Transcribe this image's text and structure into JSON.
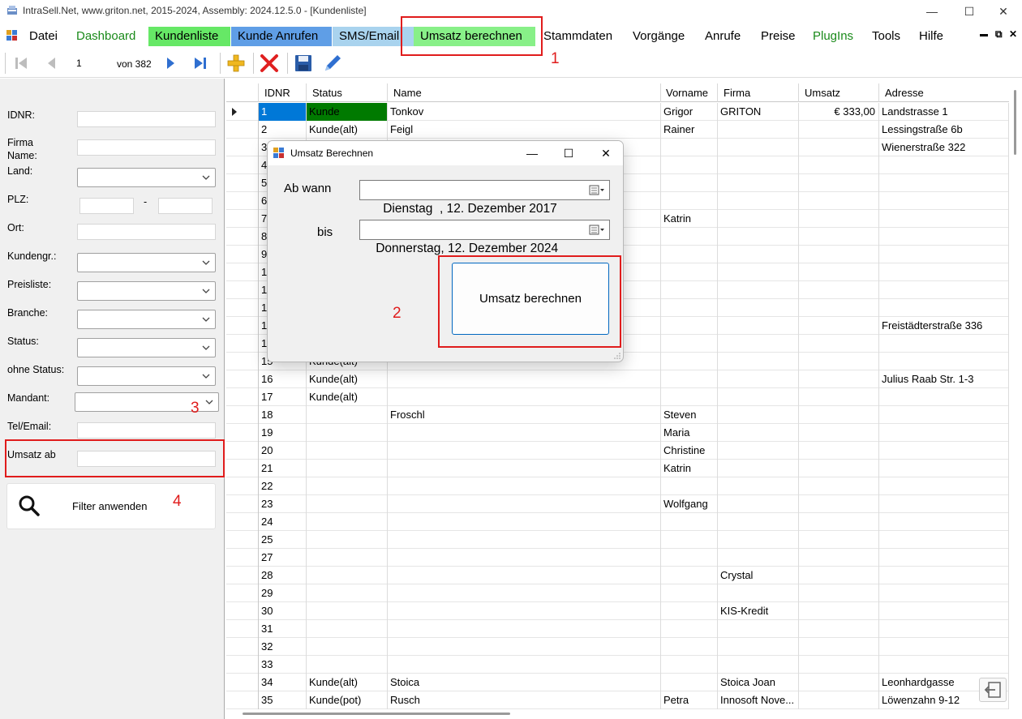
{
  "window": {
    "title": "IntraSell.Net, www.griton.net, 2015-2024, Assembly: 2024.12.5.0 - [Kundenliste]",
    "minimize": "—",
    "maximize": "☐",
    "close": "✕"
  },
  "menu": {
    "items": [
      {
        "label": "Datei",
        "bg": "",
        "color": "#000000"
      },
      {
        "label": "Dashboard",
        "bg": "",
        "color": "#1a8a1a"
      },
      {
        "label": "Kundenliste",
        "bg": "#66e866",
        "color": "#000000"
      },
      {
        "label": "Kunde Anrufen",
        "bg": "#5f9ee6",
        "color": "#000000"
      },
      {
        "label": "SMS/Email",
        "bg": "#a9d3ee",
        "color": "#000000"
      },
      {
        "label": "Umsatz berechnen",
        "bg": "#88f088",
        "color": "#000000"
      },
      {
        "label": "Stammdaten",
        "bg": "",
        "color": "#000000"
      },
      {
        "label": "Vorgänge",
        "bg": "",
        "color": "#000000"
      },
      {
        "label": "Anrufe",
        "bg": "",
        "color": "#000000"
      },
      {
        "label": "Preise",
        "bg": "",
        "color": "#000000"
      },
      {
        "label": "PlugIns",
        "bg": "",
        "color": "#1a8a1a"
      },
      {
        "label": "Tools",
        "bg": "",
        "color": "#000000"
      },
      {
        "label": "Hilfe",
        "bg": "",
        "color": "#000000"
      }
    ],
    "mdi_minimize": "▬",
    "mdi_restore": "⧉",
    "mdi_close": "✕"
  },
  "toolbar": {
    "record_value": "1",
    "record_of": "von 382"
  },
  "filter": {
    "idnr_label": "IDNR:",
    "firma_label_1": "Firma",
    "firma_label_2": "Name:",
    "land_label": "Land:",
    "plz_label": "PLZ:",
    "plz_dash": "-",
    "ort_label": "Ort:",
    "kundengr_label": "Kundengr.:",
    "preisliste_label": "Preisliste:",
    "branche_label": "Branche:",
    "status_label": "Status:",
    "ohne_status_label": "ohne Status:",
    "mandant_label": "Mandant:",
    "telemail_label": "Tel/Email:",
    "umsatz_ab_label": "Umsatz ab",
    "apply_button": "Filter anwenden"
  },
  "grid": {
    "columns": [
      "IDNR",
      "Status",
      "Name",
      "Vorname",
      "Firma",
      "Umsatz",
      "Adresse"
    ],
    "rows": [
      {
        "id": "1",
        "status": "Kunde",
        "name": "Tonkov",
        "vorname": "Grigor",
        "firma": "GRITON",
        "umsatz": "€ 333,00",
        "adresse": "Landstrasse 1"
      },
      {
        "id": "2",
        "status": "Kunde(alt)",
        "name": "Feigl",
        "vorname": "Rainer",
        "firma": "",
        "umsatz": "",
        "adresse": "Lessingstraße 6b"
      },
      {
        "id": "3",
        "status": "",
        "name": "",
        "vorname": "",
        "firma": "",
        "umsatz": "",
        "adresse": "Wienerstraße 322"
      },
      {
        "id": "4",
        "status": "",
        "name": "",
        "vorname": "",
        "firma": "",
        "umsatz": "",
        "adresse": ""
      },
      {
        "id": "5",
        "status": "",
        "name": "",
        "vorname": "",
        "firma": "",
        "umsatz": "",
        "adresse": ""
      },
      {
        "id": "6",
        "status": "",
        "name": "",
        "vorname": "",
        "firma": "",
        "umsatz": "",
        "adresse": ""
      },
      {
        "id": "7",
        "status": "",
        "name": "",
        "vorname": "Katrin",
        "firma": "",
        "umsatz": "",
        "adresse": ""
      },
      {
        "id": "8",
        "status": "",
        "name": "",
        "vorname": "",
        "firma": "",
        "umsatz": "",
        "adresse": ""
      },
      {
        "id": "9",
        "status": "",
        "name": "",
        "vorname": "",
        "firma": "",
        "umsatz": "",
        "adresse": ""
      },
      {
        "id": "1",
        "status": "",
        "name": "",
        "vorname": "",
        "firma": "",
        "umsatz": "",
        "adresse": ""
      },
      {
        "id": "1",
        "status": "",
        "name": "",
        "vorname": "",
        "firma": "",
        "umsatz": "",
        "adresse": ""
      },
      {
        "id": "1",
        "status": "",
        "name": "",
        "vorname": "",
        "firma": "",
        "umsatz": "",
        "adresse": ""
      },
      {
        "id": "1",
        "status": "",
        "name": "",
        "vorname": "",
        "firma": "",
        "umsatz": "",
        "adresse": "Freistädterstraße 336"
      },
      {
        "id": "1",
        "status": "",
        "name": "",
        "vorname": "",
        "firma": "",
        "umsatz": "",
        "adresse": ""
      },
      {
        "id": "15",
        "status": "Kunde(alt)",
        "name": "",
        "vorname": "",
        "firma": "",
        "umsatz": "",
        "adresse": ""
      },
      {
        "id": "16",
        "status": "Kunde(alt)",
        "name": "",
        "vorname": "",
        "firma": "",
        "umsatz": "",
        "adresse": "Julius Raab Str. 1-3"
      },
      {
        "id": "17",
        "status": "Kunde(alt)",
        "name": "",
        "vorname": "",
        "firma": "",
        "umsatz": "",
        "adresse": ""
      },
      {
        "id": "18",
        "status": "",
        "name": "Froschl",
        "vorname": "Steven",
        "firma": "",
        "umsatz": "",
        "adresse": ""
      },
      {
        "id": "19",
        "status": "",
        "name": "",
        "vorname": "Maria",
        "firma": "",
        "umsatz": "",
        "adresse": ""
      },
      {
        "id": "20",
        "status": "",
        "name": "",
        "vorname": "Christine",
        "firma": "",
        "umsatz": "",
        "adresse": ""
      },
      {
        "id": "21",
        "status": "",
        "name": "",
        "vorname": "Katrin",
        "firma": "",
        "umsatz": "",
        "adresse": ""
      },
      {
        "id": "22",
        "status": "",
        "name": "",
        "vorname": "",
        "firma": "",
        "umsatz": "",
        "adresse": ""
      },
      {
        "id": "23",
        "status": "",
        "name": "",
        "vorname": "Wolfgang",
        "firma": "",
        "umsatz": "",
        "adresse": ""
      },
      {
        "id": "24",
        "status": "",
        "name": "",
        "vorname": "",
        "firma": "",
        "umsatz": "",
        "adresse": ""
      },
      {
        "id": "25",
        "status": "",
        "name": "",
        "vorname": "",
        "firma": "",
        "umsatz": "",
        "adresse": ""
      },
      {
        "id": "27",
        "status": "",
        "name": "",
        "vorname": "",
        "firma": "",
        "umsatz": "",
        "adresse": ""
      },
      {
        "id": "28",
        "status": "",
        "name": "",
        "vorname": "",
        "firma": "Crystal",
        "umsatz": "",
        "adresse": ""
      },
      {
        "id": "29",
        "status": "",
        "name": "",
        "vorname": "",
        "firma": "",
        "umsatz": "",
        "adresse": ""
      },
      {
        "id": "30",
        "status": "",
        "name": "",
        "vorname": "",
        "firma": "KIS-Kredit",
        "umsatz": "",
        "adresse": ""
      },
      {
        "id": "31",
        "status": "",
        "name": "",
        "vorname": "",
        "firma": "",
        "umsatz": "",
        "adresse": ""
      },
      {
        "id": "32",
        "status": "",
        "name": "",
        "vorname": "",
        "firma": "",
        "umsatz": "",
        "adresse": ""
      },
      {
        "id": "33",
        "status": "",
        "name": "",
        "vorname": "",
        "firma": "",
        "umsatz": "",
        "adresse": ""
      },
      {
        "id": "34",
        "status": "Kunde(alt)",
        "name": "Stoica",
        "vorname": "",
        "firma": "Stoica Joan",
        "umsatz": "",
        "adresse": "Leonhardgasse"
      },
      {
        "id": "35",
        "status": "Kunde(pot)",
        "name": "Rusch",
        "vorname": "Petra",
        "firma": "Innosoft Nove...",
        "umsatz": "",
        "adresse": "Löwenzahn 9-12"
      }
    ]
  },
  "dialog": {
    "title": "Umsatz Berechnen",
    "from_label": "Ab wann",
    "to_label": "bis",
    "from_date": "Dienstag  , 12. Dezember 2017",
    "to_date": "Donnerstag, 12. Dezember 2024",
    "calculate_button": "Umsatz berechnen",
    "minimize": "—",
    "maximize": "☐",
    "close": "✕"
  },
  "annotations": {
    "n1": "1",
    "n2": "2",
    "n3": "3",
    "n4": "4",
    "color": "#e01c1c"
  },
  "colors": {
    "kunde_status": "#007a00",
    "selected_id": "#0078d7"
  }
}
